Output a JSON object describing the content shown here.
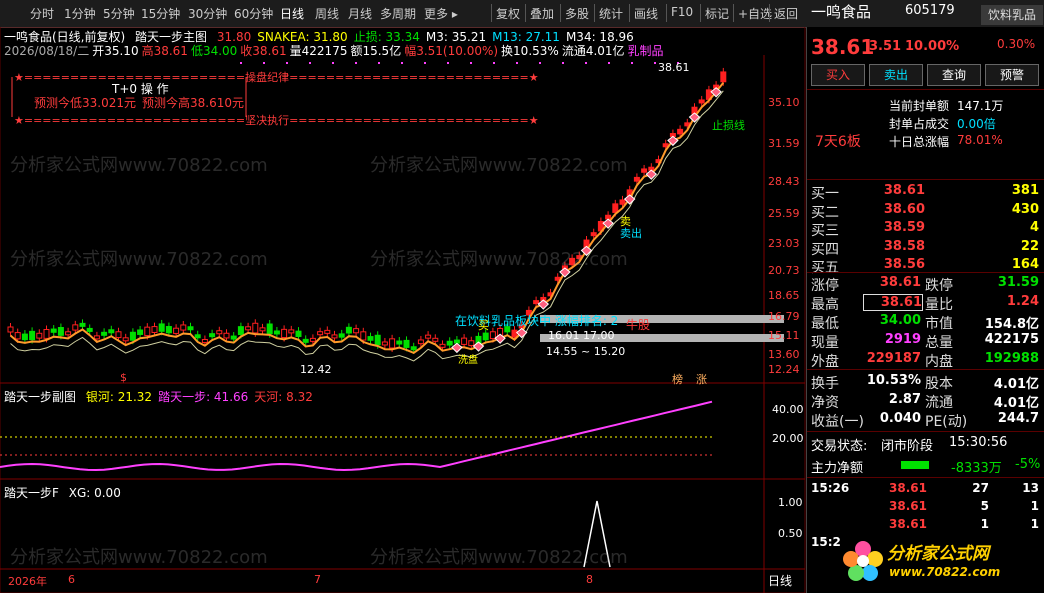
{
  "toolbar": {
    "left": [
      "分时",
      "1分钟",
      "5分钟",
      "15分钟",
      "30分钟",
      "60分钟",
      "日线",
      "周线",
      "月线",
      "多周期",
      "更多 ▸"
    ],
    "active": "日线",
    "right": [
      "复权",
      "叠加",
      "多股",
      "统计",
      "画线",
      "F10",
      "标记",
      "+自选",
      "返回"
    ]
  },
  "main_chart": {
    "title": "一鸣食品(日线,前复权)",
    "indicator_name": "踏天一步主图",
    "ind_vals": [
      {
        "text": "31.80",
        "color": "red"
      },
      {
        "text": "SNAKEA: 31.80",
        "color": "yellow"
      },
      {
        "text": "止损: 33.34",
        "color": "green"
      },
      {
        "text": "M3: 35.21",
        "color": "white"
      },
      {
        "text": "M13: 27.11",
        "color": "cyan"
      },
      {
        "text": "M34: 18.96",
        "color": "white"
      }
    ],
    "ohlc_line": [
      {
        "text": "2026/08/18/二",
        "color": "gray"
      },
      {
        "text": "开35.10",
        "color": "white"
      },
      {
        "text": "高38.61",
        "color": "red"
      },
      {
        "text": "低34.00",
        "color": "green"
      },
      {
        "text": "收38.61",
        "color": "red"
      },
      {
        "text": "量422175",
        "color": "white"
      },
      {
        "text": "额15.5亿",
        "color": "white"
      },
      {
        "text": "幅3.51(10.00%)",
        "color": "red"
      },
      {
        "text": "换10.53%",
        "color": "white"
      },
      {
        "text": "流通4.01亿",
        "color": "white"
      },
      {
        "text": "乳制品",
        "color": "magenta"
      }
    ],
    "annot_box": {
      "line1": "★========================操盘纪律==========================★",
      "line2": "T+0 操 作",
      "low_pred": "预测今低33.021元",
      "high_pred": "预测今高38.610元",
      "line4": "★========================坚决执行==========================★"
    },
    "price_axis": [
      "35.10",
      "31.59",
      "28.43",
      "25.59",
      "23.03",
      "20.73",
      "18.65",
      "16.79",
      "15.11",
      "13.60",
      "12.24"
    ],
    "labels": {
      "high_price": "38.61",
      "stop_line": "止损线",
      "sector_text": "在饮料乳品板块中 涨幅排名: 2",
      "niu": "牛股",
      "low_price": "12.42",
      "mai": "买",
      "mai2": "卖",
      "maichu": "卖出",
      "xi": "洗盘",
      "p1701": "16.01   17.00",
      "p1520": "14.55 ~ 15.20",
      "bang": "榜",
      "zhang": "涨",
      "dollar": "$"
    }
  },
  "sub_chart": {
    "name": "踏天一步副图",
    "vals": [
      {
        "text": "银河: 21.32",
        "color": "yellow"
      },
      {
        "text": "踏天一步: 41.66",
        "color": "magenta"
      },
      {
        "text": "天河: 8.32",
        "color": "red"
      }
    ],
    "axis": [
      "40.00",
      "20.00"
    ]
  },
  "third_chart": {
    "name": "踏天一步F",
    "val": "XG: 0.00",
    "axis": [
      "1.00",
      "0.50"
    ]
  },
  "date_axis": {
    "labels": [
      "2026年",
      "6",
      "7",
      "8"
    ],
    "period": "日线"
  },
  "watermark": "分析家公式网www.70822.com",
  "right_panel": {
    "stock_name": "一鸣食品",
    "code": "605179",
    "sector": "饮料乳品",
    "sector_pct": "0.30%",
    "price": "38.61",
    "change": "3.51",
    "change_pct": "10.00%",
    "buttons": [
      "买入",
      "卖出",
      "查询",
      "预警"
    ],
    "limit_info": [
      {
        "label": "当前封单额",
        "value": "147.1万"
      },
      {
        "label": "封单占成交",
        "value": "0.00倍"
      },
      {
        "label": "十日总涨幅",
        "value": "78.01%"
      }
    ],
    "boards": "7天6板",
    "bids": [
      {
        "label": "买一",
        "price": "38.61",
        "vol": "381"
      },
      {
        "label": "买二",
        "price": "38.60",
        "vol": "430"
      },
      {
        "label": "买三",
        "price": "38.59",
        "vol": "4"
      },
      {
        "label": "买四",
        "price": "38.58",
        "vol": "22"
      },
      {
        "label": "买五",
        "price": "38.56",
        "vol": "164"
      }
    ],
    "stats": [
      {
        "l1": "涨停",
        "v1": "38.61",
        "c1": "red",
        "l2": "跌停",
        "v2": "31.59",
        "c2": "green"
      },
      {
        "l1": "最高",
        "v1": "38.61",
        "c1": "red",
        "l2": "量比",
        "v2": "1.24",
        "c2": "red"
      },
      {
        "l1": "最低",
        "v1": "34.00",
        "c1": "green",
        "l2": "市值",
        "v2": "154.8亿",
        "c2": "white"
      },
      {
        "l1": "现量",
        "v1": "2919",
        "c1": "magenta",
        "l2": "总量",
        "v2": "422175",
        "c2": "white"
      },
      {
        "l1": "外盘",
        "v1": "229187",
        "c1": "red",
        "l2": "内盘",
        "v2": "192988",
        "c2": "green"
      }
    ],
    "stats2": [
      {
        "l1": "换手",
        "v1": "10.53%",
        "c1": "white",
        "l2": "股本",
        "v2": "4.01亿",
        "c2": "white"
      },
      {
        "l1": "净资",
        "v1": "2.87",
        "c1": "white",
        "l2": "流通",
        "v2": "4.01亿",
        "c2": "white"
      },
      {
        "l1": "收益(一)",
        "v1": "0.040",
        "c1": "white",
        "l2": "PE(动)",
        "v2": "244.7",
        "c2": "white"
      }
    ],
    "trade_status_label": "交易状态:",
    "trade_status": "闭市阶段",
    "trade_time": "15:30:56",
    "net_flow_label": "主力净额",
    "net_flow": "-8333万",
    "net_flow_pct": "-5%",
    "ticks": [
      {
        "time": "15:26",
        "price": "38.61",
        "vol": "27",
        "n": "13"
      },
      {
        "time": "",
        "price": "38.61",
        "vol": "5",
        "n": "1"
      },
      {
        "time": "",
        "price": "38.61",
        "vol": "1",
        "n": "1"
      },
      {
        "time": "15:2",
        "price": "",
        "vol": "",
        "n": ""
      }
    ],
    "logo_text": "分析家公式网",
    "logo_url": "www.70822.com"
  }
}
